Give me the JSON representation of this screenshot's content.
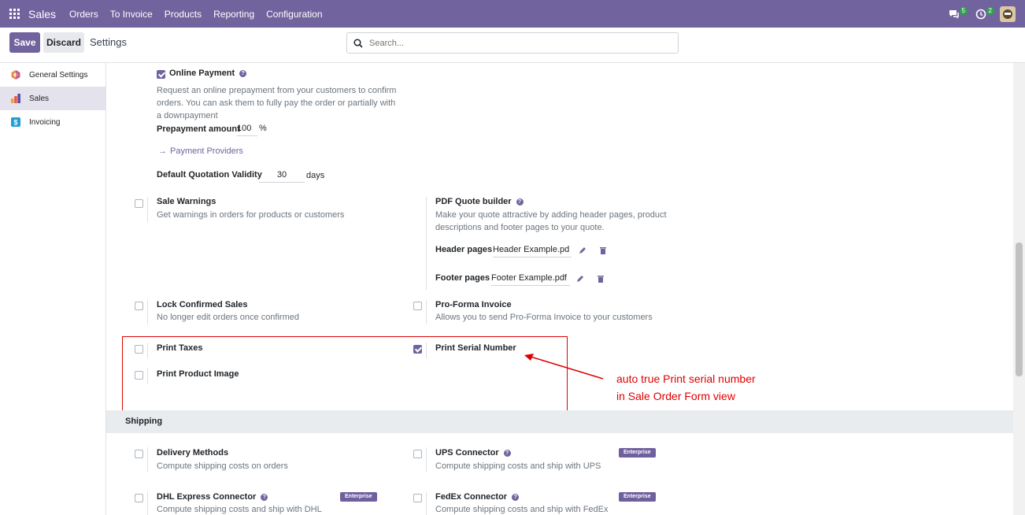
{
  "topbar": {
    "brand": "Sales",
    "menu": [
      "Orders",
      "To Invoice",
      "Products",
      "Reporting",
      "Configuration"
    ],
    "chat_badge": "5",
    "activity_badge": "2"
  },
  "controls": {
    "save": "Save",
    "discard": "Discard",
    "breadcrumb": "Settings",
    "search_placeholder": "Search..."
  },
  "sidebar": {
    "items": [
      {
        "label": "General Settings",
        "icon": "odoo-icon"
      },
      {
        "label": "Sales",
        "icon": "sales-chart-icon"
      },
      {
        "label": "Invoicing",
        "icon": "invoicing-icon"
      }
    ]
  },
  "online_payment": {
    "label": "Online Payment",
    "desc_lines": [
      "Request an online prepayment from your customers to confirm",
      "orders. You can ask them to fully pay the order or partially with",
      "a downpayment"
    ],
    "prepayment_label": "Prepayment amount",
    "prepayment_value": "100",
    "prepayment_unit": "%",
    "providers_link": "Payment Providers",
    "validity_label": "Default Quotation Validity",
    "validity_value": "30",
    "validity_unit": "days"
  },
  "settings": {
    "sale_warnings": {
      "label": "Sale Warnings",
      "desc": "Get warnings in orders for products or customers"
    },
    "pdf_quote": {
      "label": "PDF Quote builder",
      "desc_lines": [
        "Make your quote attractive by adding header pages, product",
        "descriptions and footer pages to your quote."
      ],
      "header_label": "Header pages",
      "header_value": "Header Example.pd",
      "footer_label": "Footer pages",
      "footer_value": "Footer Example.pdf"
    },
    "lock_confirmed": {
      "label": "Lock Confirmed Sales",
      "desc": "No longer edit orders once confirmed"
    },
    "pro_forma": {
      "label": "Pro-Forma Invoice",
      "desc": "Allows you to send Pro-Forma Invoice to your customers"
    },
    "print_taxes": {
      "label": "Print Taxes"
    },
    "print_serial": {
      "label": "Print Serial Number"
    },
    "print_image": {
      "label": "Print Product Image"
    }
  },
  "annotation": {
    "line1": "auto true Print serial number",
    "line2": "in Sale Order Form view",
    "color": "#e00000"
  },
  "shipping": {
    "title": "Shipping",
    "delivery": {
      "label": "Delivery Methods",
      "desc": "Compute shipping costs on orders"
    },
    "ups": {
      "label": "UPS Connector",
      "desc": "Compute shipping costs and ship with UPS",
      "badge": "Enterprise"
    },
    "dhl": {
      "label": "DHL Express Connector",
      "desc": "Compute shipping costs and ship with DHL",
      "badge": "Enterprise"
    },
    "fedex": {
      "label": "FedEx Connector",
      "desc": "Compute shipping costs and ship with FedEx",
      "badge": "Enterprise"
    }
  },
  "colors": {
    "brand": "#71639e",
    "annotation": "#e00000"
  }
}
